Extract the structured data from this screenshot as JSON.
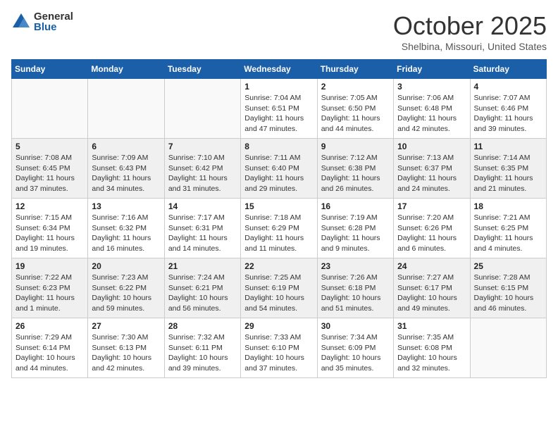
{
  "header": {
    "logo_general": "General",
    "logo_blue": "Blue",
    "month": "October 2025",
    "location": "Shelbina, Missouri, United States"
  },
  "days_of_week": [
    "Sunday",
    "Monday",
    "Tuesday",
    "Wednesday",
    "Thursday",
    "Friday",
    "Saturday"
  ],
  "weeks": [
    [
      {
        "day": "",
        "info": ""
      },
      {
        "day": "",
        "info": ""
      },
      {
        "day": "",
        "info": ""
      },
      {
        "day": "1",
        "info": "Sunrise: 7:04 AM\nSunset: 6:51 PM\nDaylight: 11 hours and 47 minutes."
      },
      {
        "day": "2",
        "info": "Sunrise: 7:05 AM\nSunset: 6:50 PM\nDaylight: 11 hours and 44 minutes."
      },
      {
        "day": "3",
        "info": "Sunrise: 7:06 AM\nSunset: 6:48 PM\nDaylight: 11 hours and 42 minutes."
      },
      {
        "day": "4",
        "info": "Sunrise: 7:07 AM\nSunset: 6:46 PM\nDaylight: 11 hours and 39 minutes."
      }
    ],
    [
      {
        "day": "5",
        "info": "Sunrise: 7:08 AM\nSunset: 6:45 PM\nDaylight: 11 hours and 37 minutes."
      },
      {
        "day": "6",
        "info": "Sunrise: 7:09 AM\nSunset: 6:43 PM\nDaylight: 11 hours and 34 minutes."
      },
      {
        "day": "7",
        "info": "Sunrise: 7:10 AM\nSunset: 6:42 PM\nDaylight: 11 hours and 31 minutes."
      },
      {
        "day": "8",
        "info": "Sunrise: 7:11 AM\nSunset: 6:40 PM\nDaylight: 11 hours and 29 minutes."
      },
      {
        "day": "9",
        "info": "Sunrise: 7:12 AM\nSunset: 6:38 PM\nDaylight: 11 hours and 26 minutes."
      },
      {
        "day": "10",
        "info": "Sunrise: 7:13 AM\nSunset: 6:37 PM\nDaylight: 11 hours and 24 minutes."
      },
      {
        "day": "11",
        "info": "Sunrise: 7:14 AM\nSunset: 6:35 PM\nDaylight: 11 hours and 21 minutes."
      }
    ],
    [
      {
        "day": "12",
        "info": "Sunrise: 7:15 AM\nSunset: 6:34 PM\nDaylight: 11 hours and 19 minutes."
      },
      {
        "day": "13",
        "info": "Sunrise: 7:16 AM\nSunset: 6:32 PM\nDaylight: 11 hours and 16 minutes."
      },
      {
        "day": "14",
        "info": "Sunrise: 7:17 AM\nSunset: 6:31 PM\nDaylight: 11 hours and 14 minutes."
      },
      {
        "day": "15",
        "info": "Sunrise: 7:18 AM\nSunset: 6:29 PM\nDaylight: 11 hours and 11 minutes."
      },
      {
        "day": "16",
        "info": "Sunrise: 7:19 AM\nSunset: 6:28 PM\nDaylight: 11 hours and 9 minutes."
      },
      {
        "day": "17",
        "info": "Sunrise: 7:20 AM\nSunset: 6:26 PM\nDaylight: 11 hours and 6 minutes."
      },
      {
        "day": "18",
        "info": "Sunrise: 7:21 AM\nSunset: 6:25 PM\nDaylight: 11 hours and 4 minutes."
      }
    ],
    [
      {
        "day": "19",
        "info": "Sunrise: 7:22 AM\nSunset: 6:23 PM\nDaylight: 11 hours and 1 minute."
      },
      {
        "day": "20",
        "info": "Sunrise: 7:23 AM\nSunset: 6:22 PM\nDaylight: 10 hours and 59 minutes."
      },
      {
        "day": "21",
        "info": "Sunrise: 7:24 AM\nSunset: 6:21 PM\nDaylight: 10 hours and 56 minutes."
      },
      {
        "day": "22",
        "info": "Sunrise: 7:25 AM\nSunset: 6:19 PM\nDaylight: 10 hours and 54 minutes."
      },
      {
        "day": "23",
        "info": "Sunrise: 7:26 AM\nSunset: 6:18 PM\nDaylight: 10 hours and 51 minutes."
      },
      {
        "day": "24",
        "info": "Sunrise: 7:27 AM\nSunset: 6:17 PM\nDaylight: 10 hours and 49 minutes."
      },
      {
        "day": "25",
        "info": "Sunrise: 7:28 AM\nSunset: 6:15 PM\nDaylight: 10 hours and 46 minutes."
      }
    ],
    [
      {
        "day": "26",
        "info": "Sunrise: 7:29 AM\nSunset: 6:14 PM\nDaylight: 10 hours and 44 minutes."
      },
      {
        "day": "27",
        "info": "Sunrise: 7:30 AM\nSunset: 6:13 PM\nDaylight: 10 hours and 42 minutes."
      },
      {
        "day": "28",
        "info": "Sunrise: 7:32 AM\nSunset: 6:11 PM\nDaylight: 10 hours and 39 minutes."
      },
      {
        "day": "29",
        "info": "Sunrise: 7:33 AM\nSunset: 6:10 PM\nDaylight: 10 hours and 37 minutes."
      },
      {
        "day": "30",
        "info": "Sunrise: 7:34 AM\nSunset: 6:09 PM\nDaylight: 10 hours and 35 minutes."
      },
      {
        "day": "31",
        "info": "Sunrise: 7:35 AM\nSunset: 6:08 PM\nDaylight: 10 hours and 32 minutes."
      },
      {
        "day": "",
        "info": ""
      }
    ]
  ]
}
